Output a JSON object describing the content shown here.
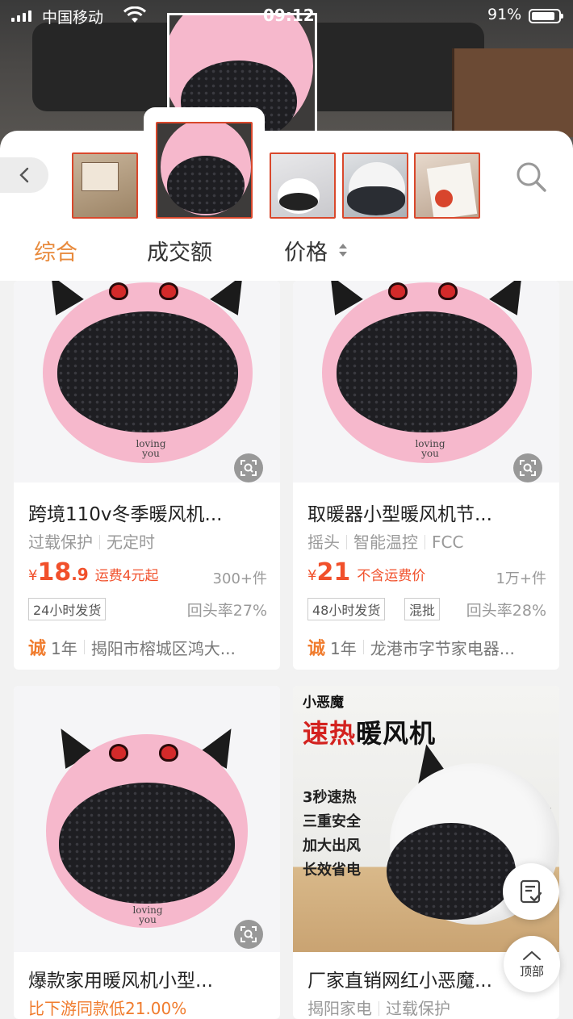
{
  "status_bar": {
    "carrier": "中国移动",
    "time": "09:12",
    "battery": "91%",
    "battery_level": 0.91
  },
  "sheet": {
    "back_icon": "chevron-left-icon",
    "search_icon": "search-icon",
    "thumbnails": [
      "box-thumb",
      "pink-heater-thumb",
      "white-heater-thumb",
      "white-heater-closeup-thumb",
      "gift-bag-thumb"
    ],
    "selected_thumbnail": 1
  },
  "tabs": {
    "items": [
      "综合",
      "成交额",
      "价格"
    ],
    "active": "综合",
    "active_color": "#e88a3c"
  },
  "products": [
    {
      "title": "跨境110v冬季暖风机...",
      "tags": [
        "过载保护",
        "无定时"
      ],
      "price_currency": "¥",
      "price_int": "18",
      "price_dec": ".9",
      "shipping": "运费4元起",
      "sold": "300+件",
      "badges": [
        "24小时发货"
      ],
      "repeat_rate": "回头率27%",
      "cheng_icon": "诚",
      "shop_years": "1年",
      "shop_name": "揭阳市榕城区鸿大..."
    },
    {
      "title": "取暖器小型暖风机节...",
      "tags": [
        "摇头",
        "智能温控",
        "FCC"
      ],
      "price_currency": "¥",
      "price_int": "21",
      "price_dec": "",
      "shipping": "不含运费价",
      "sold": "1万+件",
      "badges": [
        "48小时发货",
        "混批"
      ],
      "repeat_rate": "回头率28%",
      "cheng_icon": "诚",
      "shop_years": "1年",
      "shop_name": "龙港市字节家电器..."
    },
    {
      "title": "爆款家用暖风机小型...",
      "promo": "比下游同款低21.00%"
    },
    {
      "title": "厂家直销网红小恶魔...",
      "tags": [
        "揭阳家电",
        "过载保护"
      ],
      "ad_brand": "小恶魔",
      "ad_headline_red": "速热",
      "ad_headline_rest": "暖风机",
      "ad_bullets": [
        "3秒速热",
        "三重安全",
        "加大出风",
        "长效省电"
      ]
    }
  ],
  "heater_brand": "loving you",
  "floating": {
    "feedback_icon": "feedback-icon",
    "top_label": "顶部",
    "top_icon": "chevron-up-icon"
  },
  "colors": {
    "price_red": "#f1502b",
    "accent_orange": "#f07c2e",
    "thumb_border": "#d9482c"
  }
}
